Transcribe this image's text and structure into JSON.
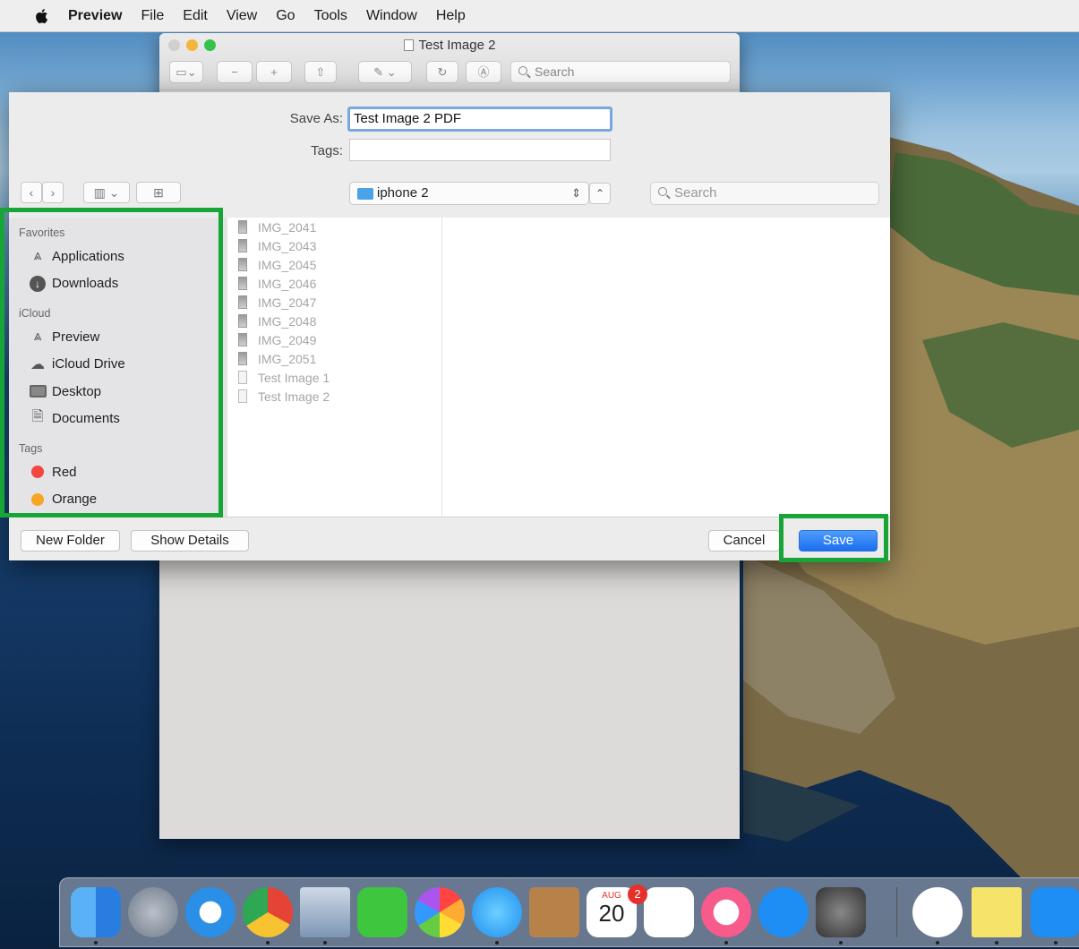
{
  "menubar": {
    "app_name": "Preview",
    "items": [
      "File",
      "Edit",
      "View",
      "Go",
      "Tools",
      "Window",
      "Help"
    ]
  },
  "preview_window": {
    "title": "Test Image 2",
    "search_placeholder": "Search"
  },
  "save_sheet": {
    "save_as_label": "Save As:",
    "save_as_value": "Test Image 2 PDF",
    "tags_label": "Tags:",
    "tags_value": "",
    "location": "iphone 2",
    "search_placeholder": "Search",
    "sidebar": {
      "favorites_header": "Favorites",
      "favorites": [
        {
          "label": "Applications",
          "icon": "applications-icon"
        },
        {
          "label": "Downloads",
          "icon": "downloads-icon"
        }
      ],
      "icloud_header": "iCloud",
      "icloud": [
        {
          "label": "Preview",
          "icon": "preview-app-icon"
        },
        {
          "label": "iCloud Drive",
          "icon": "cloud-icon"
        },
        {
          "label": "Desktop",
          "icon": "desktop-icon"
        },
        {
          "label": "Documents",
          "icon": "documents-icon"
        }
      ],
      "tags_header": "Tags",
      "tags": [
        {
          "label": "Red",
          "color": "#f0483e"
        },
        {
          "label": "Orange",
          "color": "#f5a623"
        }
      ]
    },
    "files": [
      "IMG_2041",
      "IMG_2043",
      "IMG_2045",
      "IMG_2046",
      "IMG_2047",
      "IMG_2048",
      "IMG_2049",
      "IMG_2051",
      "Test Image 1",
      "Test Image 2"
    ],
    "buttons": {
      "new_folder": "New Folder",
      "show_details": "Show Details",
      "cancel": "Cancel",
      "save": "Save"
    }
  },
  "dock": {
    "apps": [
      "finder-icon",
      "launchpad-icon",
      "safari-icon",
      "chrome-icon",
      "preview-icon",
      "facetime-icon",
      "photos-icon",
      "messages-icon",
      "contacts-icon",
      "calendar-icon",
      "reminders-icon",
      "music-icon",
      "app-store-icon",
      "system-preferences-icon",
      "parallels-icon",
      "stickies-icon",
      "teamviewer-icon"
    ],
    "calendar_month": "AUG",
    "calendar_day": "20",
    "calendar_badge": "2"
  },
  "colors": {
    "highlight": "#16a536",
    "accent": "#1b6ff0"
  }
}
